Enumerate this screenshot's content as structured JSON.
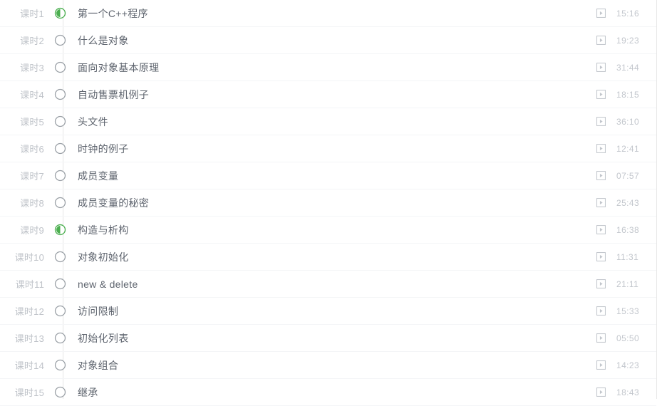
{
  "colors": {
    "accent_green": "#4caf50",
    "circle_idle_stroke": "#9aa0a6",
    "index_text": "#bfc3c9",
    "title_text": "#5e646e",
    "duration_text": "#c2c6cc",
    "rail": "#e6e6e6",
    "row_divider": "#f4f5f7",
    "panel_border": "#e8e8e8",
    "background": "#ffffff"
  },
  "icons": {
    "status_progress": "half-filled-circle-icon",
    "status_empty": "empty-circle-icon",
    "play": "play-square-icon"
  },
  "lessons": [
    {
      "index": "课时1",
      "title": "第一个C++程序",
      "duration": "15:16",
      "status": "progress"
    },
    {
      "index": "课时2",
      "title": "什么是对象",
      "duration": "19:23",
      "status": "empty"
    },
    {
      "index": "课时3",
      "title": "面向对象基本原理",
      "duration": "31:44",
      "status": "empty"
    },
    {
      "index": "课时4",
      "title": "自动售票机例子",
      "duration": "18:15",
      "status": "empty"
    },
    {
      "index": "课时5",
      "title": "头文件",
      "duration": "36:10",
      "status": "empty"
    },
    {
      "index": "课时6",
      "title": "时钟的例子",
      "duration": "12:41",
      "status": "empty"
    },
    {
      "index": "课时7",
      "title": "成员变量",
      "duration": "07:57",
      "status": "empty"
    },
    {
      "index": "课时8",
      "title": "成员变量的秘密",
      "duration": "25:43",
      "status": "empty"
    },
    {
      "index": "课时9",
      "title": "构造与析构",
      "duration": "16:38",
      "status": "progress"
    },
    {
      "index": "课时10",
      "title": "对象初始化",
      "duration": "11:31",
      "status": "empty"
    },
    {
      "index": "课时11",
      "title": "new & delete",
      "duration": "21:11",
      "status": "empty"
    },
    {
      "index": "课时12",
      "title": "访问限制",
      "duration": "15:33",
      "status": "empty"
    },
    {
      "index": "课时13",
      "title": "初始化列表",
      "duration": "05:50",
      "status": "empty"
    },
    {
      "index": "课时14",
      "title": "对象组合",
      "duration": "14:23",
      "status": "empty"
    },
    {
      "index": "课时15",
      "title": "继承",
      "duration": "18:43",
      "status": "empty"
    }
  ]
}
